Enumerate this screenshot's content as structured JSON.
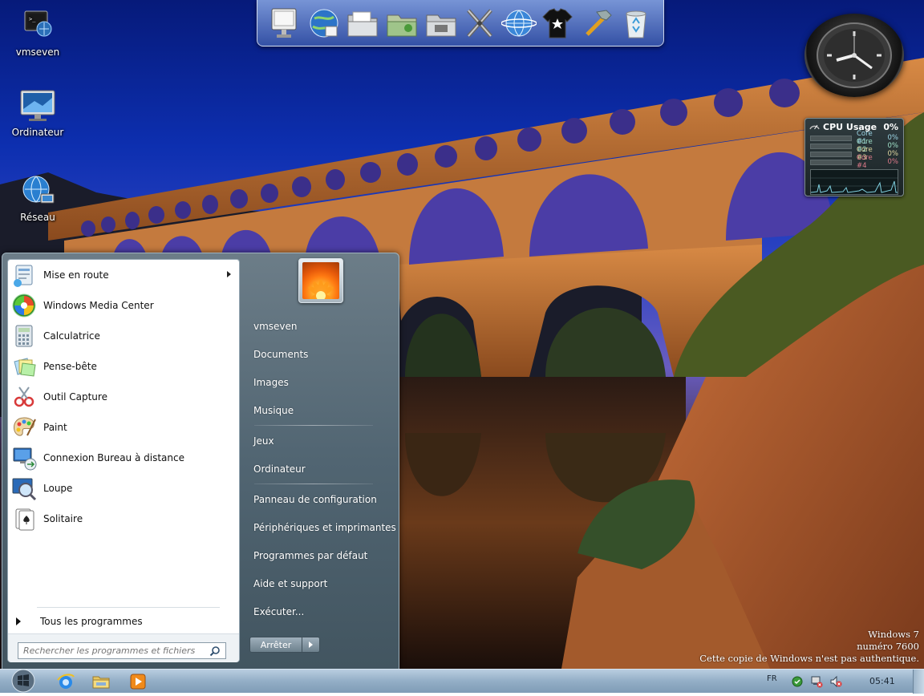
{
  "desktop": {
    "icons": [
      {
        "label": "vmseven",
        "icon": "user-computer-icon"
      },
      {
        "label": "Ordinateur",
        "icon": "computer-icon"
      },
      {
        "label": "Réseau",
        "icon": "network-globe-icon"
      }
    ]
  },
  "dock": {
    "items": [
      "computer-icon",
      "internet-globe-icon",
      "documents-folder-icon",
      "green-folder-icon",
      "control-panel-icon",
      "tools-icon",
      "network-globe-icon",
      "tshirt-icon",
      "hammer-icon",
      "recycle-bin-icon"
    ]
  },
  "cpu_gadget": {
    "title": "CPU Usage",
    "total": "0%",
    "cores": [
      {
        "name": "Core #1",
        "value": "0%"
      },
      {
        "name": "Core #2",
        "value": "0%"
      },
      {
        "name": "Core #3",
        "value": "0%"
      },
      {
        "name": "Core #4",
        "value": "0%"
      }
    ]
  },
  "start_menu": {
    "programs": [
      {
        "label": "Mise en route",
        "icon": "getting-started-icon",
        "has_submenu": true
      },
      {
        "label": "Windows Media Center",
        "icon": "media-center-icon"
      },
      {
        "label": "Calculatrice",
        "icon": "calculator-icon"
      },
      {
        "label": "Pense-bête",
        "icon": "sticky-notes-icon"
      },
      {
        "label": "Outil Capture",
        "icon": "snipping-tool-icon"
      },
      {
        "label": "Paint",
        "icon": "paint-palette-icon"
      },
      {
        "label": "Connexion Bureau à distance",
        "icon": "remote-desktop-icon"
      },
      {
        "label": "Loupe",
        "icon": "magnifier-icon"
      },
      {
        "label": "Solitaire",
        "icon": "solitaire-cards-icon"
      }
    ],
    "all_programs": "Tous les programmes",
    "search_placeholder": "Rechercher les programmes et fichiers",
    "right_items": [
      {
        "label": "vmseven"
      },
      {
        "label": "Documents"
      },
      {
        "label": "Images"
      },
      {
        "label": "Musique"
      },
      {
        "label": "Jeux"
      },
      {
        "label": "Ordinateur"
      },
      {
        "label": "Panneau de configuration"
      },
      {
        "label": "Périphériques et imprimantes"
      },
      {
        "label": "Programmes par défaut"
      },
      {
        "label": "Aide et support"
      },
      {
        "label": "Exécuter..."
      }
    ],
    "shutdown_label": "Arrêter"
  },
  "watermark": {
    "line1": "Windows 7",
    "line2": "numéro 7600",
    "line3": "Cette copie de Windows n'est pas authentique."
  },
  "taskbar": {
    "pinned": [
      "internet-explorer-icon",
      "explorer-folder-icon",
      "media-player-icon"
    ],
    "tray": {
      "language": "FR",
      "time": "05:41"
    }
  }
}
